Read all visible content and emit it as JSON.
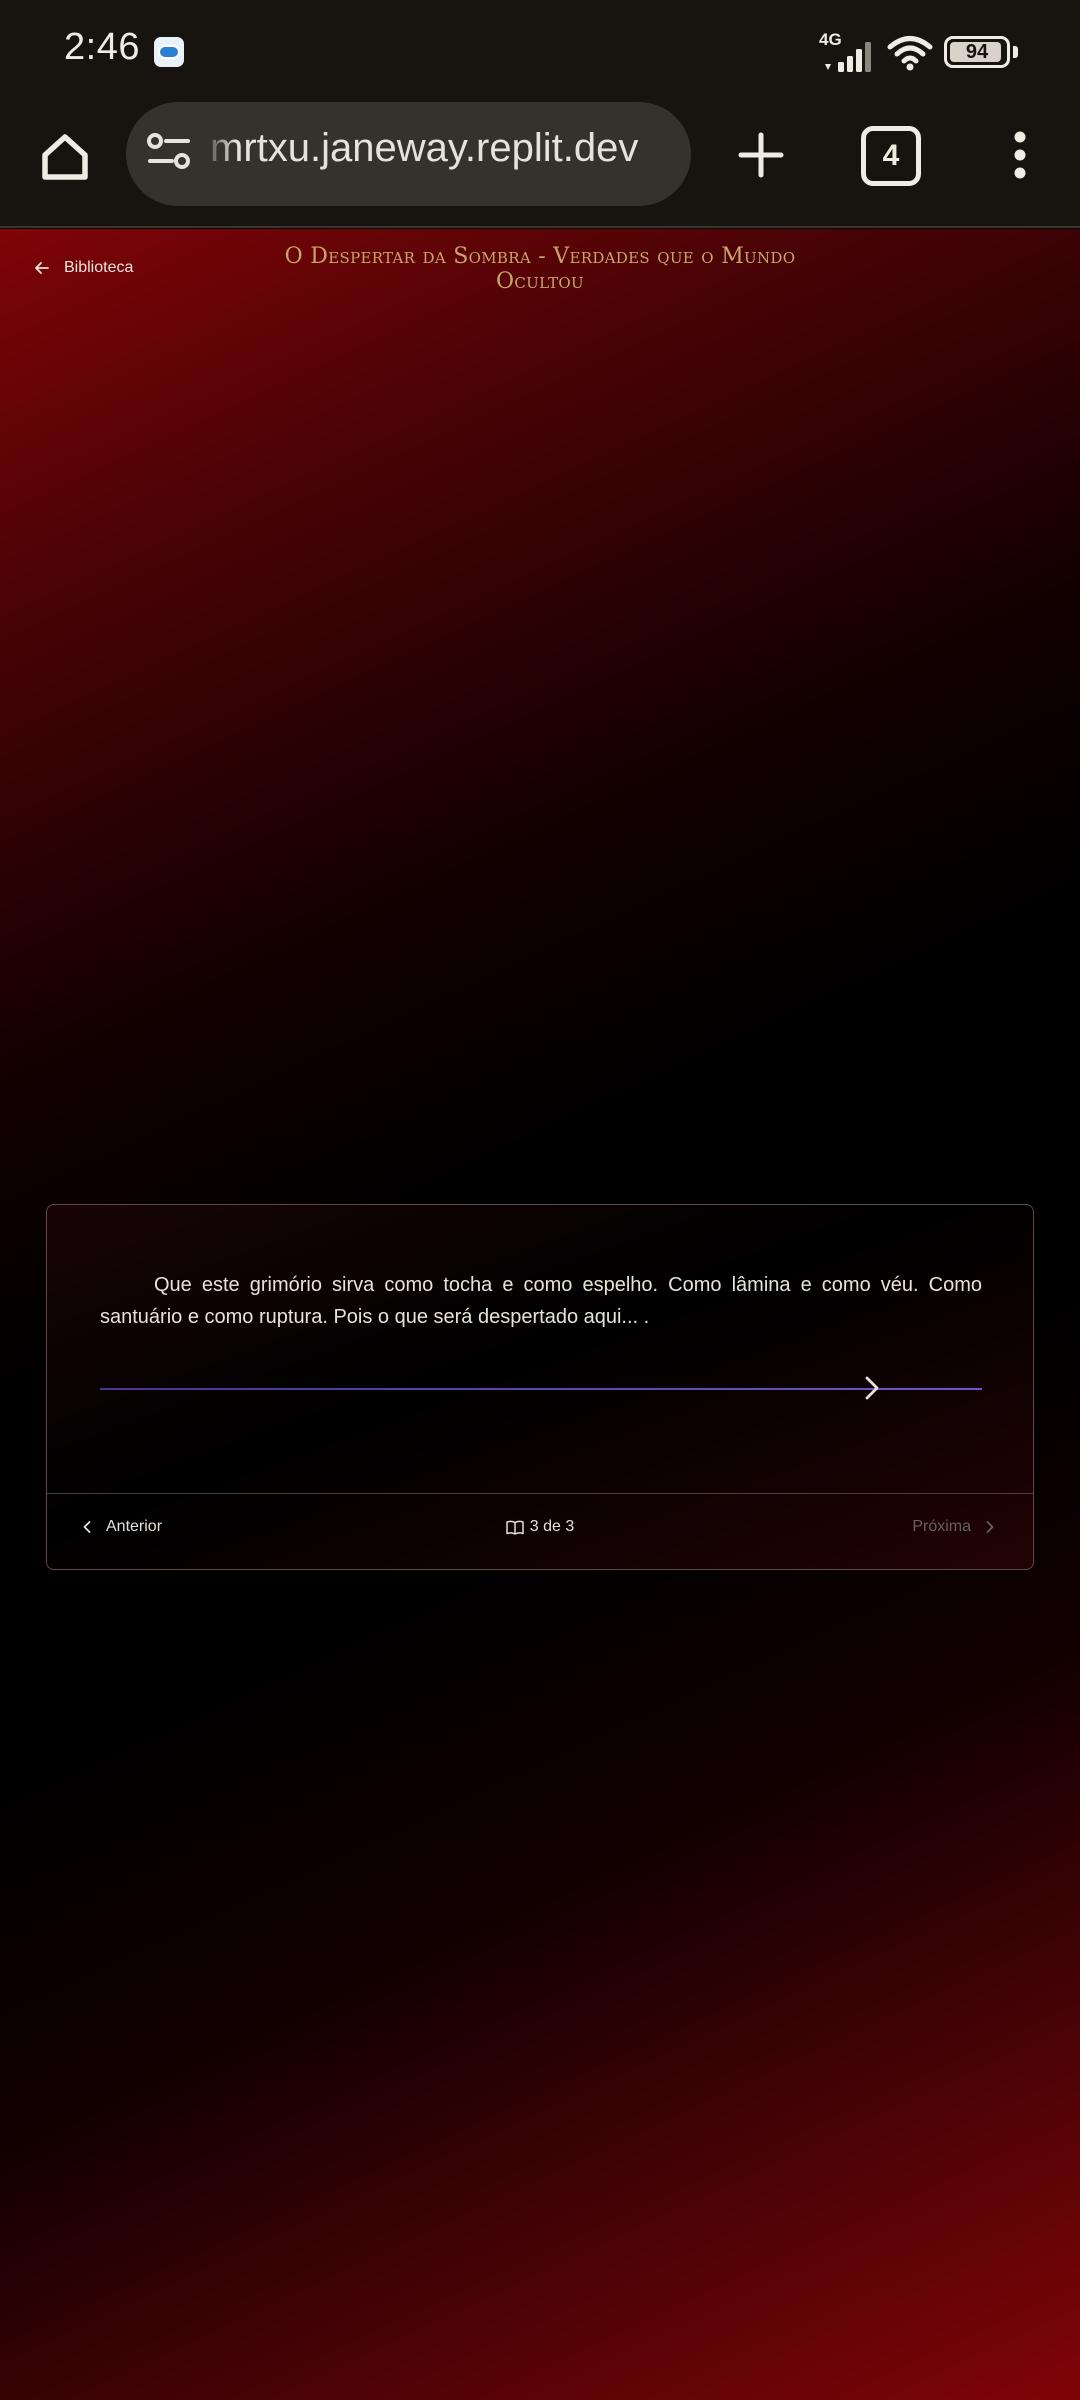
{
  "status_bar": {
    "time": "2:46",
    "network": "4G",
    "battery": "94",
    "battery_level": 0.94
  },
  "browser": {
    "url": "mrtxu.janeway.replit.dev",
    "tab_count": "4"
  },
  "reader": {
    "back_label": "Biblioteca",
    "title": "O Despertar da Sombra - Verdades que o Mundo Ocultou",
    "passage": "Que este grimório sirva como tocha e como espelho. Como lâmina e como véu. Como santuário e como ruptura. Pois o que será despertado aqui... .",
    "prev_label": "Anterior",
    "page_indicator": "3 de 3",
    "next_label": "Próxima"
  },
  "colors": {
    "accent_gold": "#c9a56a",
    "progress_purple": "#6d56c8",
    "background_red": "#800407"
  },
  "icons": [
    "home-icon",
    "tune-icon",
    "plus-icon",
    "more-vert-icon",
    "arrow-left-icon",
    "chevron-left-icon",
    "chevron-right-icon",
    "book-open-icon",
    "signal-icon",
    "wifi-icon",
    "battery-icon"
  ]
}
